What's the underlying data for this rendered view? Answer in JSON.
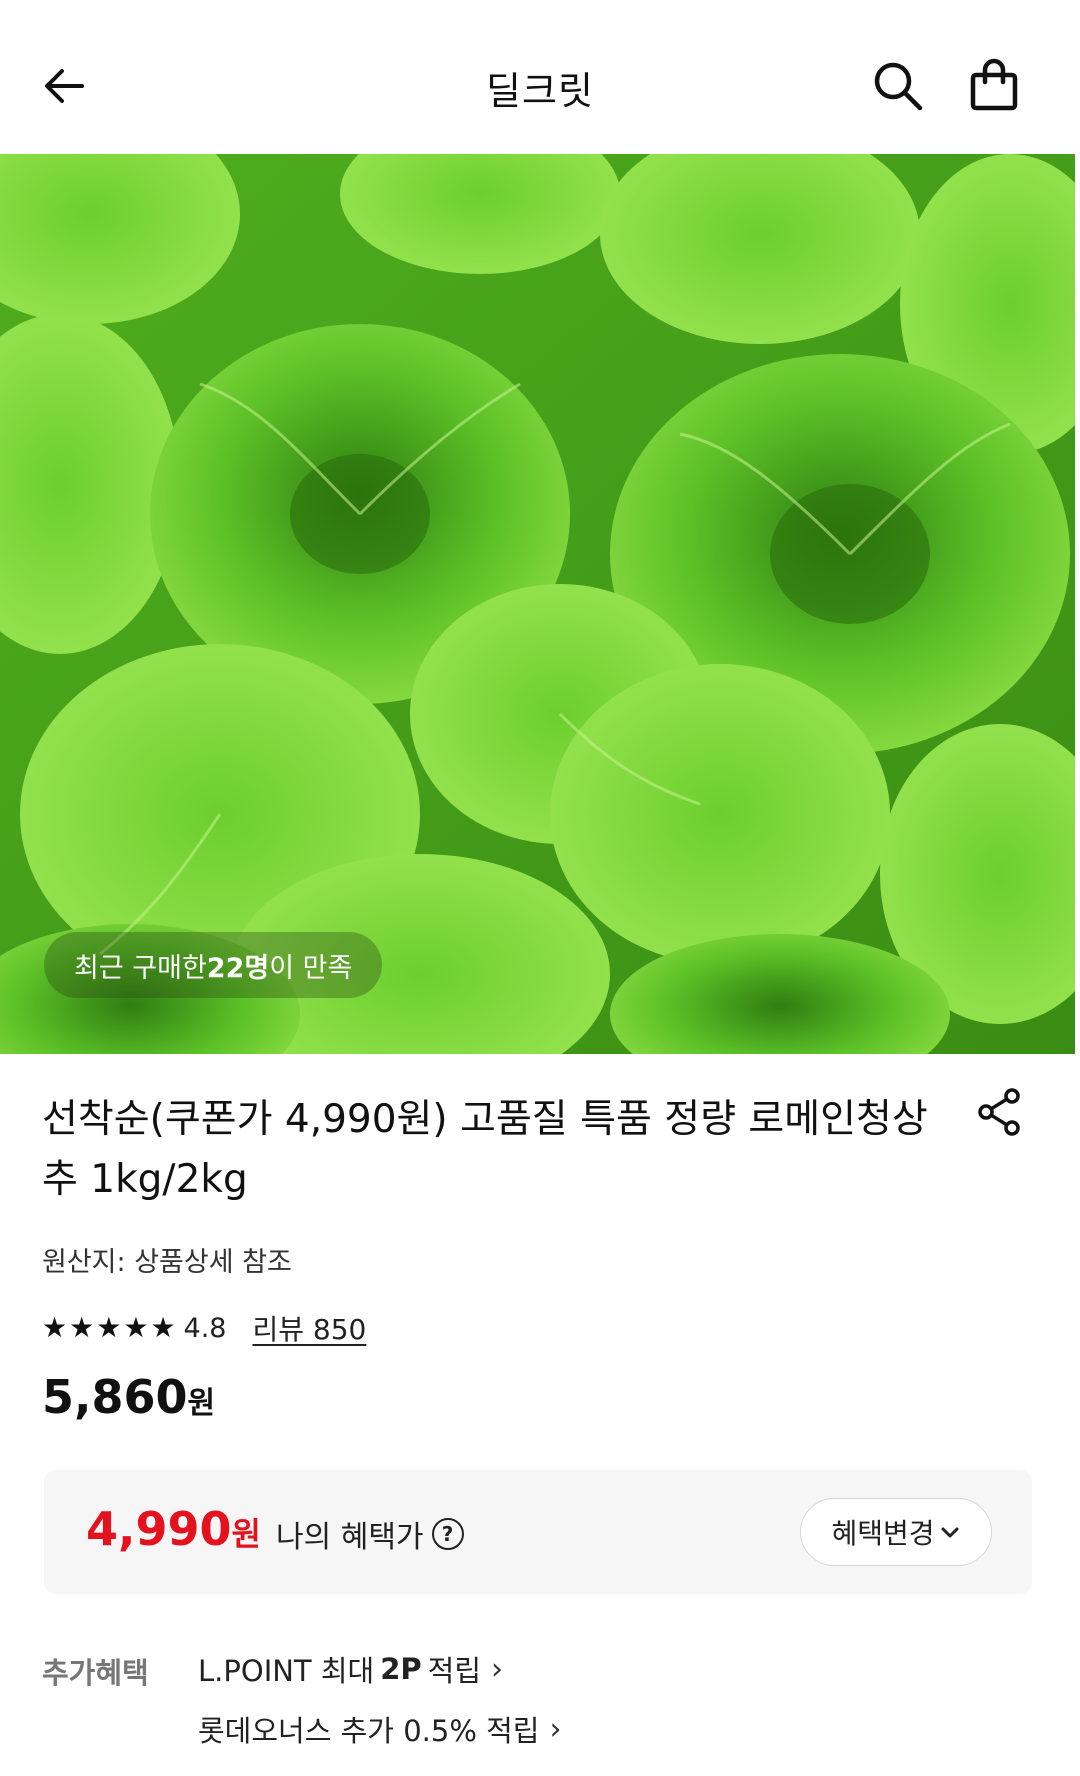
{
  "header": {
    "title": "딜크릿",
    "back_icon": "arrow-left-icon",
    "search_icon": "search-icon",
    "cart_icon": "shopping-bag-icon"
  },
  "hero": {
    "image": "romaine-lettuce-photo",
    "satisfaction_prefix": "최근 구매한 ",
    "satisfaction_count": "22명",
    "satisfaction_suffix": "이 만족"
  },
  "product": {
    "title": "선착순(쿠폰가 4,990원) 고품질 특품 정량 로메인청상추 1kg/2kg",
    "origin": "원산지: 상품상세 참조",
    "stars": [
      "★",
      "★",
      "★",
      "★",
      "★"
    ],
    "rating": "4.8",
    "review_label": "리뷰 850",
    "price_number": "5,860",
    "price_unit": "원"
  },
  "benefit": {
    "price_number": "4,990",
    "price_unit": "원",
    "label": "나의 혜택가",
    "help_glyph": "?",
    "change_label": "혜택변경",
    "change_chevron": "⌄"
  },
  "extra": {
    "label": "추가혜택",
    "item1_prefix": "L.POINT 최대",
    "item1_bold": "2P",
    "item1_suffix": "적립",
    "item2": "롯데오너스 추가 0.5% 적립",
    "chevron": "›"
  },
  "colors": {
    "accent_red": "#e4121e",
    "lettuce_green": "#5cc027"
  }
}
